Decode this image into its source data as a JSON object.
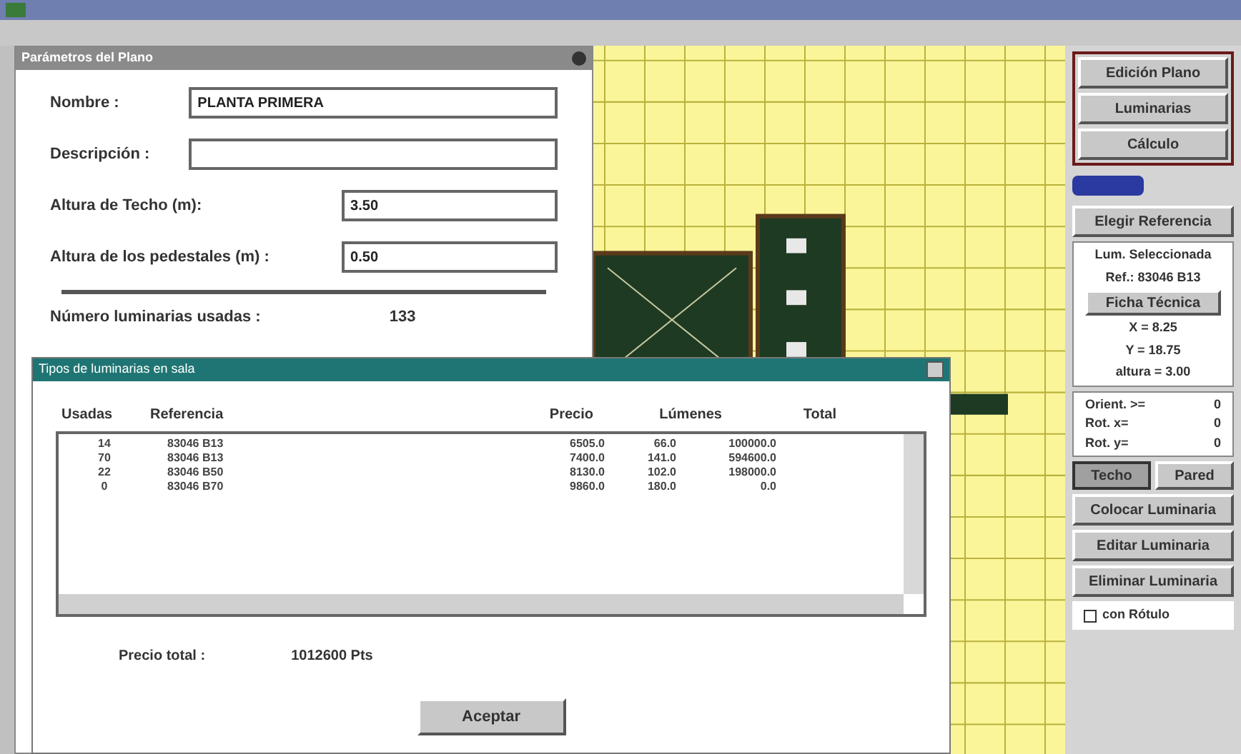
{
  "plan_dialog": {
    "title": "Parámetros del Plano",
    "fields": [
      {
        "label": "Nombre :",
        "value": "PLANTA PRIMERA"
      },
      {
        "label": "Descripción :"
      },
      {
        "label": "Altura de Techo (m):",
        "value": "3.50"
      },
      {
        "label": "Altura de los pedestales (m) :",
        "value": "0.50"
      }
    ],
    "count_label": "Número luminarias usadas :",
    "count_value": "133"
  },
  "right_panel": {
    "mode_buttons": [
      {
        "label": "Edición Plano"
      },
      {
        "label": "Luminarias"
      },
      {
        "label": "Cálculo"
      }
    ],
    "choose_button": "Elegir Referencia",
    "selected_label": "Lum. Seleccionada",
    "reference": "Ref.: 83046 B13",
    "sheet_button": "Ficha Técnica",
    "coords": [
      "X = 8.25",
      "Y = 18.75",
      "altura = 3.00"
    ],
    "rotations": [
      {
        "label": "Orient. >=",
        "value": "0"
      },
      {
        "label": "Rot. x=",
        "value": "0"
      },
      {
        "label": "Rot. y=",
        "value": "0"
      }
    ],
    "surfaces": [
      {
        "label": "Techo",
        "selected": true
      },
      {
        "label": "Pared",
        "selected": false
      }
    ],
    "actions": [
      "Colocar Luminaria",
      "Editar Luminaria",
      "Eliminar Luminaria"
    ],
    "label_checkbox": {
      "label": "con Rótulo",
      "checked": false
    }
  },
  "types_dialog": {
    "title": "Tipos de luminarias en sala",
    "columns": [
      "Usadas",
      "Referencia",
      "Precio",
      "Lúmenes",
      "Total"
    ],
    "rows": [
      [
        "14",
        "83046 B13",
        "6505.0",
        "66.0",
        "100000.0"
      ],
      [
        "70",
        "83046 B13",
        "7400.0",
        "141.0",
        "594600.0"
      ],
      [
        "22",
        "83046 B50",
        "8130.0",
        "102.0",
        "198000.0"
      ],
      [
        "0",
        "83046 B70",
        "9860.0",
        "180.0",
        "0.0"
      ]
    ],
    "total_label": "Precio total :",
    "total_value": "1012600 Pts",
    "ok_button": "Aceptar"
  }
}
